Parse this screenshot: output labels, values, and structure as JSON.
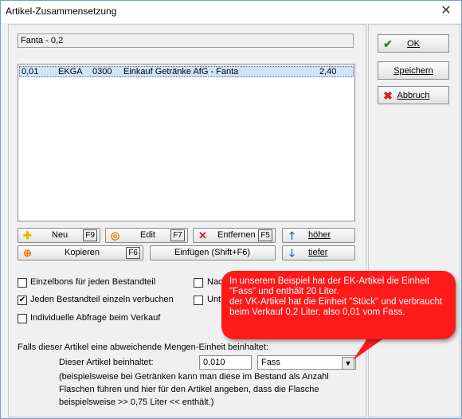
{
  "window": {
    "title": "Artikel-Zusammensetzung",
    "close_glyph": "✕"
  },
  "artikel": {
    "value": "Fanta - 0,2"
  },
  "list": {
    "rows": [
      {
        "menge": "0,01",
        "lieferant": "EKGA",
        "nr": "0300",
        "bezeichnung": "Einkauf Getränke AfG - Fanta",
        "preis": "2,40"
      }
    ]
  },
  "toolbar": {
    "neu": {
      "label": "Neu",
      "key": "F9",
      "icon": "plus-icon"
    },
    "edit": {
      "label": "Edit",
      "key": "F7",
      "icon": "edit-icon"
    },
    "entfernen": {
      "label": "Entfernen",
      "key": "F5",
      "icon": "remove-icon"
    },
    "hoeher": {
      "label": "höher",
      "icon": "arrow-up-icon"
    },
    "kopieren": {
      "label": "Kopieren",
      "key": "F6",
      "icon": "copy-icon"
    },
    "einfuegen": {
      "label": "Einfügen (Shift+F6)"
    },
    "tiefer": {
      "label": "tiefer",
      "icon": "arrow-down-icon"
    }
  },
  "options": {
    "einzelbons": {
      "label": "Einzelbons für jeden Bestandteil",
      "checked": false
    },
    "jeden_bestandteil": {
      "label": "Jeden Bestandteil einzeln verbuchen",
      "checked": true
    },
    "individuelle": {
      "label": "Individuelle Abfrage beim Verkauf",
      "checked": false
    },
    "nac": {
      "label": "Nac",
      "checked": false
    },
    "unt": {
      "label": "Unt",
      "checked": false
    }
  },
  "unit": {
    "heading": "Falls dieser Artikel eine abweichende Mengen-Einheit beinhaltet:",
    "label": "Dieser Artikel beinhaltet:",
    "amount": "0,010",
    "selected_unit": "Fass",
    "help_line1": "(beispielsweise bei Getränken kann man diese im Bestand als Anzahl",
    "help_line2": "Flaschen führen und hier für den Artikel angeben, dass die Flasche",
    "help_line3": "beispielsweise >> 0,75 Liter << enthält.)"
  },
  "buttons": {
    "ok": {
      "label": "OK",
      "icon": "check-icon"
    },
    "speichern": {
      "label": "Speichern"
    },
    "abbruch": {
      "label": "Abbruch",
      "icon": "cancel-icon"
    }
  },
  "callout": {
    "text": "In unserem Beispiel hat der EK-Artikel die Einheit \"Fass\" und enthält 20 Liter.\nder VK-Artikel hat die Einheit \"Stück\" und verbraucht beim Verkauf 0,2 Liter, also 0,01 vom Fass."
  },
  "colors": {
    "callout": "#ff1a1a",
    "selection": "#cfe3ff",
    "accent_green": "#1e8f1e",
    "accent_red": "#d81e1e",
    "accent_blue": "#1f5fbf",
    "accent_orange": "#f07a10"
  }
}
